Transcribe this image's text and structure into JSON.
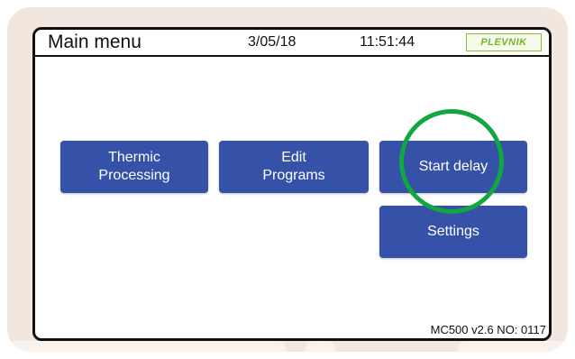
{
  "screen": {
    "title": "Main menu",
    "date": "3/05/18",
    "time": "11:51:44",
    "brand": "PLEVNIK",
    "version": "MC500 v2.6 NO: 0117"
  },
  "buttons": {
    "thermic_processing": [
      "Thermic",
      "Processing"
    ],
    "edit_programs": [
      "Edit",
      "Programs"
    ],
    "start_delay": "Start delay",
    "settings": "Settings"
  },
  "colors": {
    "button_blue": "#3552a8",
    "highlight_green": "#12a640",
    "device_bezel": "#f1e7df",
    "brand_green": "#74b52f"
  },
  "annotation": {
    "highlighted_button": "start-delay-button",
    "shape": "circle"
  }
}
